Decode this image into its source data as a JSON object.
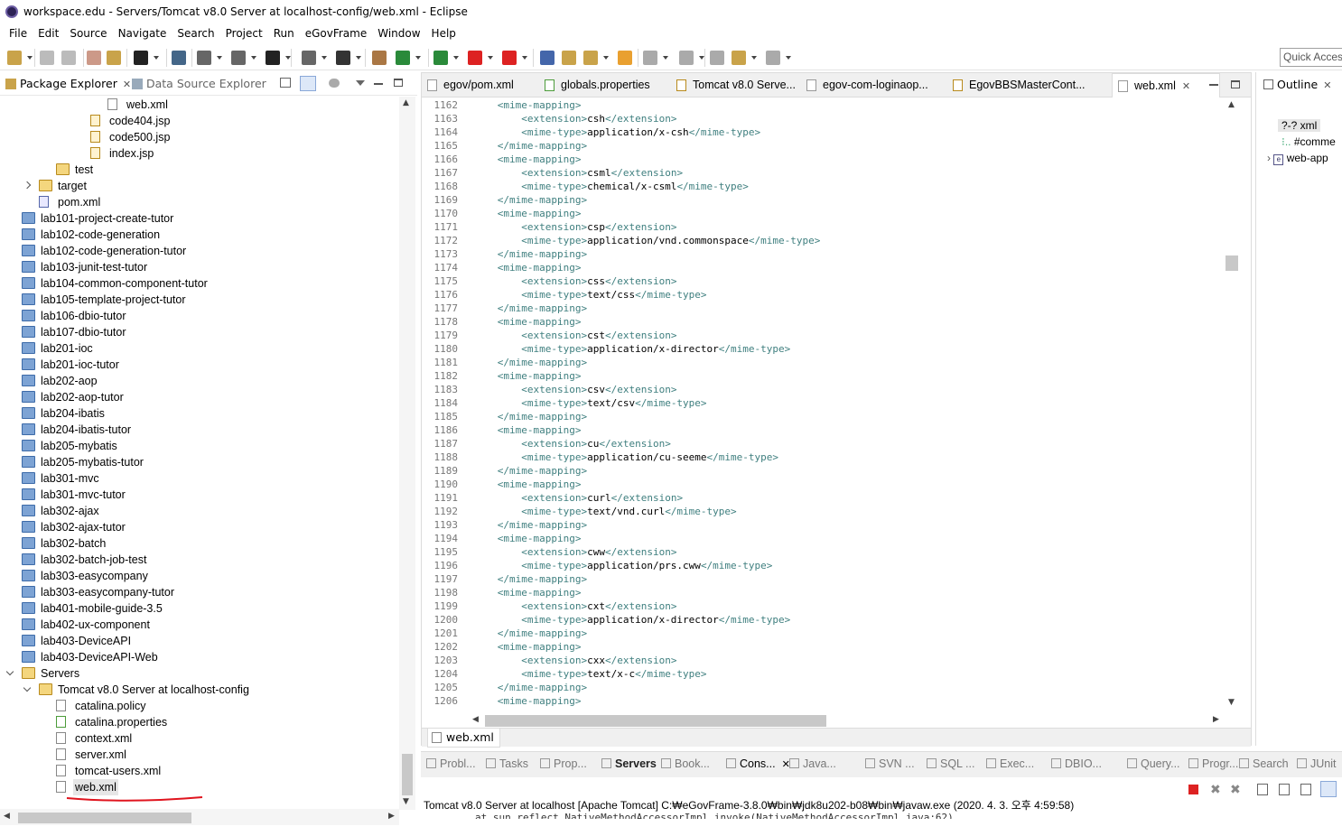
{
  "window": {
    "title": "workspace.edu - Servers/Tomcat v8.0 Server at localhost-config/web.xml - Eclipse"
  },
  "menu": [
    "File",
    "Edit",
    "Source",
    "Navigate",
    "Search",
    "Project",
    "Run",
    "eGovFrame",
    "Window",
    "Help"
  ],
  "quick_access": {
    "placeholder": "Quick Access"
  },
  "left_panel": {
    "tab_active": "Package Explorer",
    "tab_other": "Data Source Explorer"
  },
  "tree": [
    {
      "label": "web.xml",
      "indent": 6,
      "icon": "xml"
    },
    {
      "label": "code404.jsp",
      "indent": 5,
      "icon": "jsp"
    },
    {
      "label": "code500.jsp",
      "indent": 5,
      "icon": "jsp"
    },
    {
      "label": "index.jsp",
      "indent": 5,
      "icon": "jsp"
    },
    {
      "label": "test",
      "indent": 3,
      "icon": "ofolder"
    },
    {
      "label": "target",
      "indent": 2,
      "icon": "ofolder",
      "twisty": "closed"
    },
    {
      "label": "pom.xml",
      "indent": 2,
      "icon": "pom"
    },
    {
      "label": "lab101-project-create-tutor",
      "indent": 1,
      "icon": "folder"
    },
    {
      "label": "lab102-code-generation",
      "indent": 1,
      "icon": "folder"
    },
    {
      "label": "lab102-code-generation-tutor",
      "indent": 1,
      "icon": "folder"
    },
    {
      "label": "lab103-junit-test-tutor",
      "indent": 1,
      "icon": "folder"
    },
    {
      "label": "lab104-common-component-tutor",
      "indent": 1,
      "icon": "folder"
    },
    {
      "label": "lab105-template-project-tutor",
      "indent": 1,
      "icon": "folder"
    },
    {
      "label": "lab106-dbio-tutor",
      "indent": 1,
      "icon": "folder"
    },
    {
      "label": "lab107-dbio-tutor",
      "indent": 1,
      "icon": "folder"
    },
    {
      "label": "lab201-ioc",
      "indent": 1,
      "icon": "folder"
    },
    {
      "label": "lab201-ioc-tutor",
      "indent": 1,
      "icon": "folder"
    },
    {
      "label": "lab202-aop",
      "indent": 1,
      "icon": "folder"
    },
    {
      "label": "lab202-aop-tutor",
      "indent": 1,
      "icon": "folder"
    },
    {
      "label": "lab204-ibatis",
      "indent": 1,
      "icon": "folder"
    },
    {
      "label": "lab204-ibatis-tutor",
      "indent": 1,
      "icon": "folder"
    },
    {
      "label": "lab205-mybatis",
      "indent": 1,
      "icon": "folder"
    },
    {
      "label": "lab205-mybatis-tutor",
      "indent": 1,
      "icon": "folder"
    },
    {
      "label": "lab301-mvc",
      "indent": 1,
      "icon": "folder"
    },
    {
      "label": "lab301-mvc-tutor",
      "indent": 1,
      "icon": "folder"
    },
    {
      "label": "lab302-ajax",
      "indent": 1,
      "icon": "folder"
    },
    {
      "label": "lab302-ajax-tutor",
      "indent": 1,
      "icon": "folder"
    },
    {
      "label": "lab302-batch",
      "indent": 1,
      "icon": "folder"
    },
    {
      "label": "lab302-batch-job-test",
      "indent": 1,
      "icon": "folder"
    },
    {
      "label": "lab303-easycompany",
      "indent": 1,
      "icon": "folder"
    },
    {
      "label": "lab303-easycompany-tutor",
      "indent": 1,
      "icon": "folder"
    },
    {
      "label": "lab401-mobile-guide-3.5",
      "indent": 1,
      "icon": "folder"
    },
    {
      "label": "lab402-ux-component",
      "indent": 1,
      "icon": "folder"
    },
    {
      "label": "lab403-DeviceAPI",
      "indent": 1,
      "icon": "folder"
    },
    {
      "label": "lab403-DeviceAPI-Web",
      "indent": 1,
      "icon": "folder"
    },
    {
      "label": "Servers",
      "indent": 1,
      "icon": "ofolder",
      "twisty": "open"
    },
    {
      "label": "Tomcat v8.0 Server at localhost-config",
      "indent": 2,
      "icon": "ofolder",
      "twisty": "open"
    },
    {
      "label": "catalina.policy",
      "indent": 3,
      "icon": "xml"
    },
    {
      "label": "catalina.properties",
      "indent": 3,
      "icon": "prop"
    },
    {
      "label": "context.xml",
      "indent": 3,
      "icon": "xml"
    },
    {
      "label": "server.xml",
      "indent": 3,
      "icon": "xml"
    },
    {
      "label": "tomcat-users.xml",
      "indent": 3,
      "icon": "xml"
    },
    {
      "label": "web.xml",
      "indent": 3,
      "icon": "xml",
      "selected": true
    }
  ],
  "editor_tabs": [
    "egov/pom.xml",
    "globals.properties",
    "Tomcat v8.0 Serve...",
    "egov-com-loginaop...",
    "EgovBBSMasterCont...",
    "web.xml"
  ],
  "code_lines": [
    {
      "n": "1162",
      "t": "open",
      "s": "mime-mapping"
    },
    {
      "n": "1163",
      "t": "ext",
      "v": "csh"
    },
    {
      "n": "1164",
      "t": "mime",
      "v": "application/x-csh"
    },
    {
      "n": "1165",
      "t": "close",
      "s": "mime-mapping"
    },
    {
      "n": "1166",
      "t": "open",
      "s": "mime-mapping"
    },
    {
      "n": "1167",
      "t": "ext",
      "v": "csml"
    },
    {
      "n": "1168",
      "t": "mime",
      "v": "chemical/x-csml"
    },
    {
      "n": "1169",
      "t": "close",
      "s": "mime-mapping"
    },
    {
      "n": "1170",
      "t": "open",
      "s": "mime-mapping"
    },
    {
      "n": "1171",
      "t": "ext",
      "v": "csp"
    },
    {
      "n": "1172",
      "t": "mime",
      "v": "application/vnd.commonspace"
    },
    {
      "n": "1173",
      "t": "close",
      "s": "mime-mapping"
    },
    {
      "n": "1174",
      "t": "open",
      "s": "mime-mapping"
    },
    {
      "n": "1175",
      "t": "ext",
      "v": "css"
    },
    {
      "n": "1176",
      "t": "mime",
      "v": "text/css"
    },
    {
      "n": "1177",
      "t": "close",
      "s": "mime-mapping"
    },
    {
      "n": "1178",
      "t": "open",
      "s": "mime-mapping"
    },
    {
      "n": "1179",
      "t": "ext",
      "v": "cst"
    },
    {
      "n": "1180",
      "t": "mime",
      "v": "application/x-director"
    },
    {
      "n": "1181",
      "t": "close",
      "s": "mime-mapping"
    },
    {
      "n": "1182",
      "t": "open",
      "s": "mime-mapping"
    },
    {
      "n": "1183",
      "t": "ext",
      "v": "csv"
    },
    {
      "n": "1184",
      "t": "mime",
      "v": "text/csv"
    },
    {
      "n": "1185",
      "t": "close",
      "s": "mime-mapping"
    },
    {
      "n": "1186",
      "t": "open",
      "s": "mime-mapping"
    },
    {
      "n": "1187",
      "t": "ext",
      "v": "cu"
    },
    {
      "n": "1188",
      "t": "mime",
      "v": "application/cu-seeme"
    },
    {
      "n": "1189",
      "t": "close",
      "s": "mime-mapping"
    },
    {
      "n": "1190",
      "t": "open",
      "s": "mime-mapping"
    },
    {
      "n": "1191",
      "t": "ext",
      "v": "curl"
    },
    {
      "n": "1192",
      "t": "mime",
      "v": "text/vnd.curl"
    },
    {
      "n": "1193",
      "t": "close",
      "s": "mime-mapping"
    },
    {
      "n": "1194",
      "t": "open",
      "s": "mime-mapping"
    },
    {
      "n": "1195",
      "t": "ext",
      "v": "cww"
    },
    {
      "n": "1196",
      "t": "mime",
      "v": "application/prs.cww"
    },
    {
      "n": "1197",
      "t": "close",
      "s": "mime-mapping"
    },
    {
      "n": "1198",
      "t": "open",
      "s": "mime-mapping"
    },
    {
      "n": "1199",
      "t": "ext",
      "v": "cxt"
    },
    {
      "n": "1200",
      "t": "mime",
      "v": "application/x-director"
    },
    {
      "n": "1201",
      "t": "close",
      "s": "mime-mapping"
    },
    {
      "n": "1202",
      "t": "open",
      "s": "mime-mapping"
    },
    {
      "n": "1203",
      "t": "ext",
      "v": "cxx"
    },
    {
      "n": "1204",
      "t": "mime",
      "v": "text/x-c"
    },
    {
      "n": "1205",
      "t": "close",
      "s": "mime-mapping"
    },
    {
      "n": "1206",
      "t": "open",
      "s": "mime-mapping"
    }
  ],
  "editor_bottom_tab": "web.xml",
  "outline": {
    "title": "Outline",
    "items": [
      "?-? xml",
      "#comme",
      "web-app"
    ]
  },
  "console_tabs": [
    "Probl...",
    "Tasks",
    "Prop...",
    "Servers",
    "Book...",
    "Cons...",
    "Java...",
    "SVN ...",
    "SQL ...",
    "Exec...",
    "DBIO...",
    "Query...",
    "Progr...",
    "Search",
    "JUnit"
  ],
  "console": {
    "header": "Tomcat v8.0 Server at localhost [Apache Tomcat] C:₩eGovFrame-3.8.0₩bin₩jdk8u202-b08₩bin₩javaw.exe (2020. 4. 3. 오후 4:59:58)"
  },
  "colors": {
    "tag": "#3f7f7f",
    "annotation": "#e0141e",
    "selection": "#e6e6e6"
  }
}
